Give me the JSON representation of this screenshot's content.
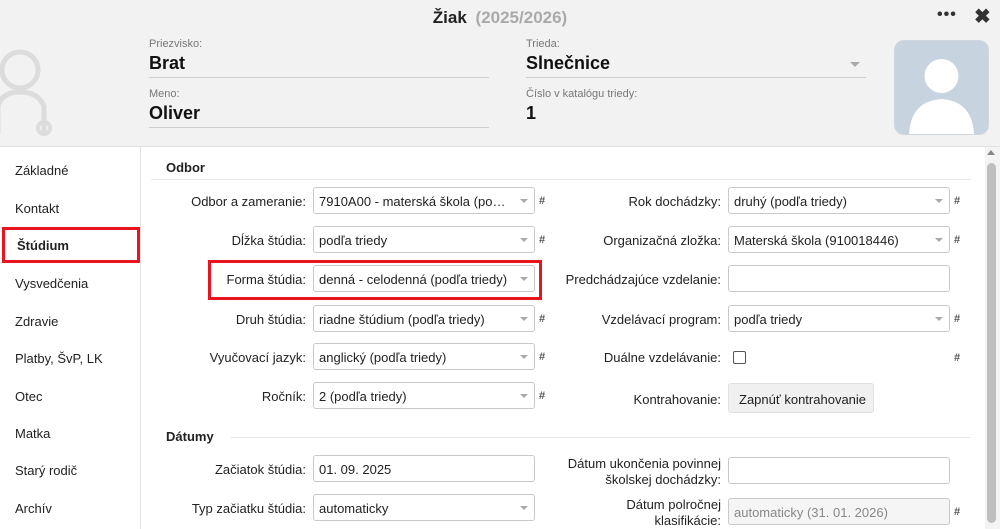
{
  "window": {
    "title": "Žiak",
    "year": "(2025/2026)",
    "more_icon": "•••",
    "close_icon": "✖"
  },
  "header": {
    "surname_label": "Priezvisko:",
    "surname": "Brat",
    "name_label": "Meno:",
    "name": "Oliver",
    "class_label": "Trieda:",
    "class": "Slnečnice",
    "catalog_label": "Číslo v katalógu triedy:",
    "catalog": "1"
  },
  "sidebar": {
    "items": [
      {
        "label": "Základné"
      },
      {
        "label": "Kontakt"
      },
      {
        "label": "Štúdium"
      },
      {
        "label": "Vysvedčenia"
      },
      {
        "label": "Zdravie"
      },
      {
        "label": "Platby, ŠvP, LK"
      },
      {
        "label": "Otec"
      },
      {
        "label": "Matka"
      },
      {
        "label": "Starý rodič"
      },
      {
        "label": "Archív"
      }
    ]
  },
  "odbor": {
    "section_title": "Odbor",
    "odbor_label": "Odbor a zameranie:",
    "odbor_value": "7910A00 - materská škola (podľa...",
    "dlzka_label": "Dĺžka štúdia:",
    "dlzka_value": "podľa triedy",
    "forma_label": "Forma štúdia:",
    "forma_value": "denná - celodenná (podľa triedy)",
    "druh_label": "Druh štúdia:",
    "druh_value": "riadne štúdium (podľa triedy)",
    "jazyk_label": "Vyučovací jazyk:",
    "jazyk_value": "anglický (podľa triedy)",
    "rocnik_label": "Ročník:",
    "rocnik_value": "2 (podľa triedy)",
    "rok_label": "Rok dochádzky:",
    "rok_value": "druhý (podľa triedy)",
    "zlozka_label": "Organizačná zložka:",
    "zlozka_value": "Materská škola (910018446)",
    "predch_label": "Predchádzajúce vzdelanie:",
    "predch_value": "",
    "program_label": "Vzdelávací program:",
    "program_value": "podľa triedy",
    "dualne_label": "Duálne vzdelávanie:",
    "kontr_label": "Kontrahovanie:",
    "kontr_button": "Zapnúť kontrahovanie",
    "hash": "#"
  },
  "datumy": {
    "section_title": "Dátumy",
    "zaciatok_label": "Začiatok štúdia:",
    "zaciatok_value": "01. 09. 2025",
    "typ_label": "Typ začiatku štúdia:",
    "typ_value": "automaticky",
    "ukoncenie_label_1": "Dátum ukončenia povinnej",
    "ukoncenie_label_2": "školskej dochádzky:",
    "ukoncenie_value": "",
    "polrocnej_label_1": "Dátum polročnej",
    "polrocnej_label_2": "klasifikácie:",
    "polrocnej_value": "automaticky (31. 01. 2026)"
  },
  "colors": {
    "highlight": "#e8141f",
    "header_bg": "#f2f2f2",
    "photo_bg": "#c8d3e0"
  }
}
